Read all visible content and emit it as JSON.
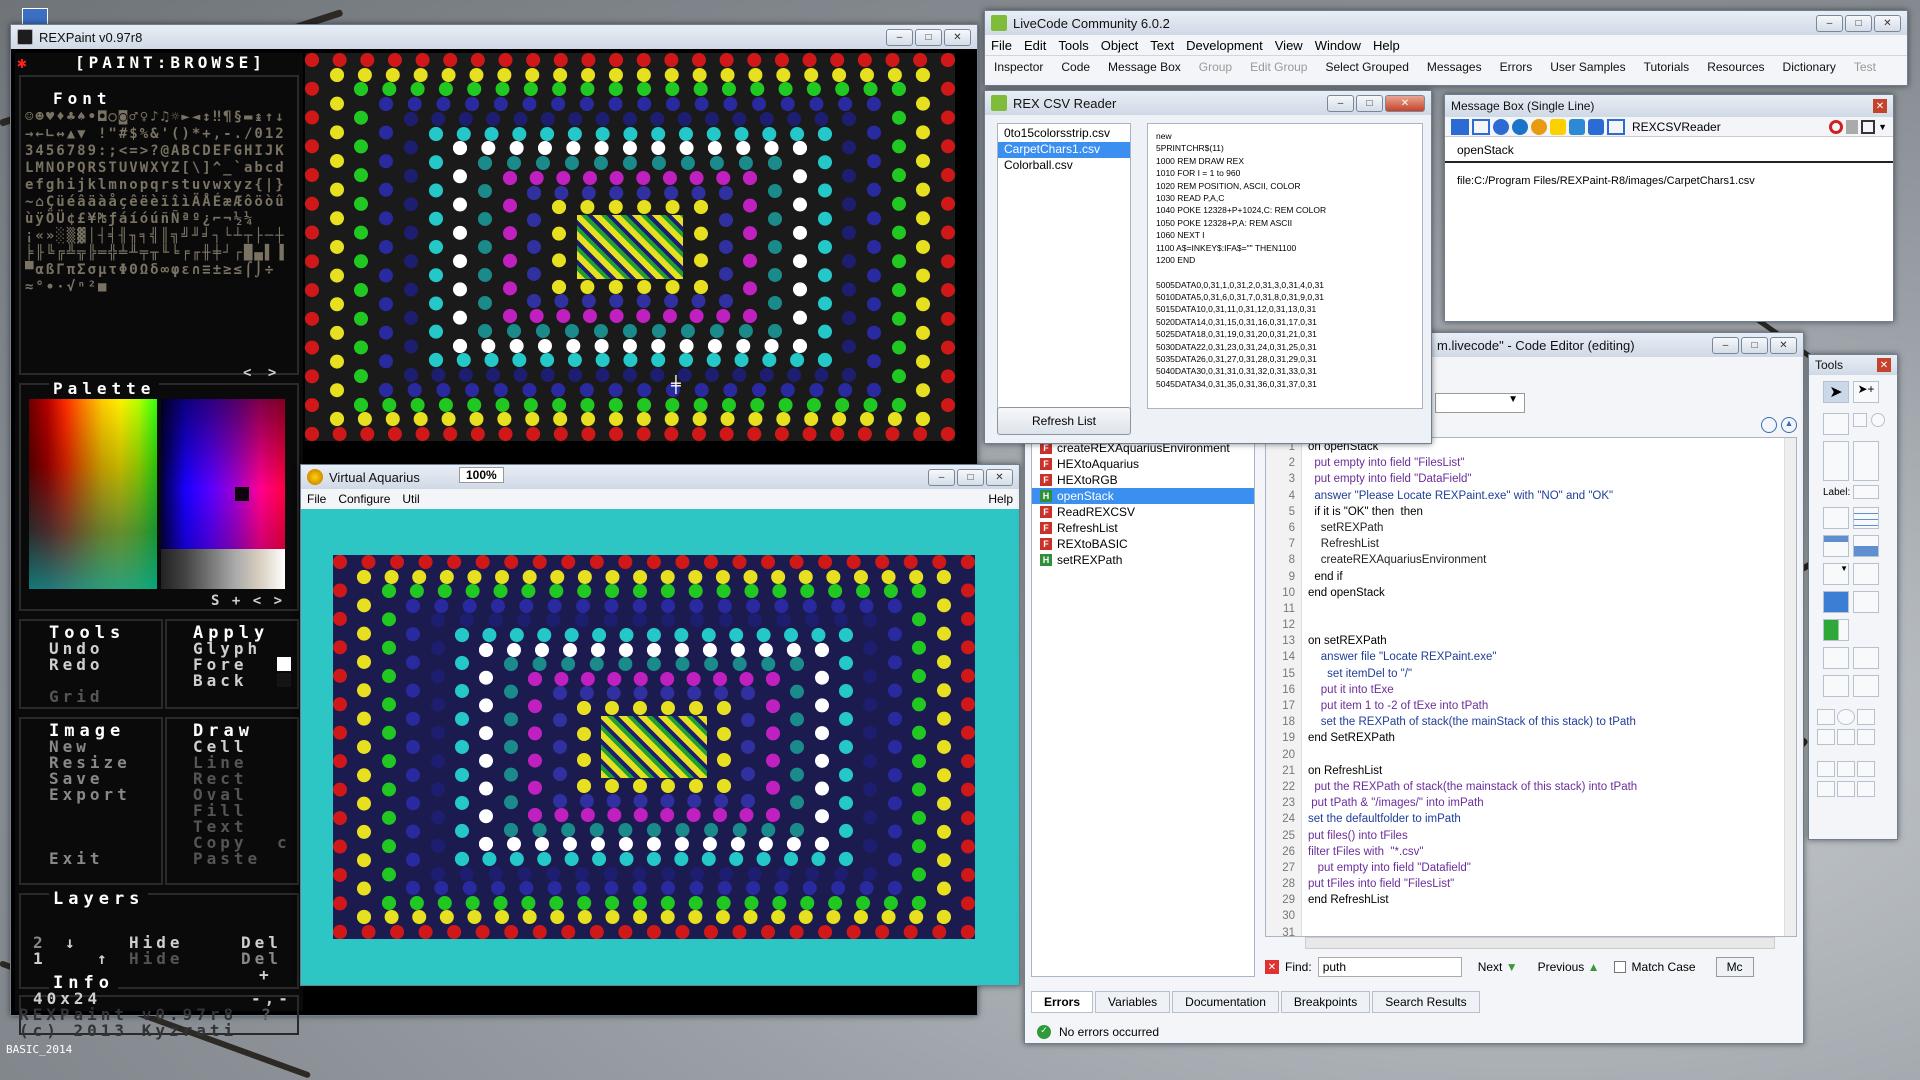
{
  "desktop": {
    "label": "BASIC_2014"
  },
  "rexpaint": {
    "title": "REXPaint v0.97r8",
    "mode_tab": "[PAINT:BROWSE]",
    "font_heading": "Font",
    "font_glyphs": "☺☻♥♦♣♠•◘○◙♂♀♪♫☼►◄↕‼¶§▬↨↑↓→←∟↔▲▼ !\"#$%&'()*+,-./0123456789:;<=>?@ABCDEFGHIJKLMNOPQRSTUVWXYZ[\\]^_`abcdefghijklmnopqrstuvwxyz{|}~⌂ÇüéâäàåçêëèïîìÄÅÉæÆôöòûùÿÖÜ¢£¥₧ƒáíóúñÑªº¿⌐¬½¼¡«»░▒▓│┤╡╢╖╕╣║╗╝╜╛┐└┴┬├─┼╞╟╚╔╩╦╠═╬╧╨╤╥╙╘╒╓╫╪┘┌█▄▌▐▀αßΓπΣσµτΦΘΩδ∞φε∩≡±≥≤⌠⌡÷≈°∙·√ⁿ²■",
    "font_nav": "< >",
    "palette_heading": "Palette",
    "palette_nav": "S + < >",
    "tools_heading": "Tools",
    "undo": "Undo",
    "redo": "Redo",
    "grid": "Grid",
    "apply_heading": "Apply",
    "glyph": "Glyph",
    "fore": "Fore",
    "back": "Back",
    "image_heading": "Image",
    "new": "New",
    "resize": "Resize",
    "save": "Save",
    "export": "Export",
    "exit": "Exit",
    "draw_heading": "Draw",
    "cell": "Cell",
    "line": "Line",
    "rect": "Rect",
    "oval": "Oval",
    "fill": "Fill",
    "text": "Text",
    "copy": "Copy",
    "paste": "Paste",
    "copy_c": "c",
    "layers_heading": "Layers",
    "layer_2": "2",
    "layer_1": "1",
    "hide_2": "Hide",
    "hide_1": "Hide",
    "del_2": "Del",
    "del_1": "Del",
    "layer_add": "+",
    "info_heading": "Info",
    "info_size": "40x24",
    "info_coords": "-,-",
    "info_help": "?",
    "footer_version": "REXPaint v0.97r8",
    "footer_copy": "(c) 2013 Kyzrati"
  },
  "aquarius": {
    "title": "Virtual Aquarius",
    "zoom": "100%",
    "menu": [
      "File",
      "Configure",
      "Util"
    ],
    "help": "Help"
  },
  "livecode": {
    "title": "LiveCode Community 6.0.2",
    "menu": [
      "File",
      "Edit",
      "Tools",
      "Object",
      "Text",
      "Development",
      "View",
      "Window",
      "Help"
    ],
    "toolbar": [
      "Inspector",
      "Code",
      "Message Box",
      "Group",
      "Edit Group",
      "Select Grouped",
      "Messages",
      "Errors",
      "User Samples",
      "Tutorials",
      "Resources",
      "Dictionary",
      "Test"
    ]
  },
  "csvreader": {
    "title": "REX CSV Reader",
    "files": [
      "0to15colorsstrip.csv",
      "CarpetChars1.csv",
      "Colorball.csv"
    ],
    "selected_index": 1,
    "data_lines": [
      "new",
      "5PRINTCHR$(11)",
      "1000 REM DRAW REX",
      "1010 FOR I = 1 to 960",
      "1020 REM POSITION, ASCII, COLOR",
      "1030 READ P,A,C",
      "1040 POKE 12328+P+1024,C: REM COLOR",
      "1050 POKE 12328+P,A: REM ASCII",
      "1060 NEXT I",
      "1100 A$=INKEY$:IFA$=\"\" THEN1100",
      "1200 END",
      "",
      "5005DATA0,0,31,1,0,31,2,0,31,3,0,31,4,0,31",
      "5010DATA5,0,31,6,0,31,7,0,31,8,0,31,9,0,31",
      "5015DATA10,0,31,11,0,31,12,0,31,13,0,31",
      "5020DATA14,0,31,15,0,31,16,0,31,17,0,31",
      "5025DATA18,0,31,19,0,31,20,0,31,21,0,31",
      "5030DATA22,0,31,23,0,31,24,0,31,25,0,31",
      "5035DATA26,0,31,27,0,31,28,0,31,29,0,31",
      "5040DATA30,0,31,31,0,31,32,0,31,33,0,31",
      "5045DATA34,0,31,35,0,31,36,0,31,37,0,31"
    ],
    "refresh_button": "Refresh List"
  },
  "messagebox": {
    "title": "Message Box (Single Line)",
    "stack_name": "REXCSVReader",
    "command": "openStack",
    "result": "file:C:/Program Files/REXPaint-R8/images/CarpetChars1.csv"
  },
  "codeeditor": {
    "title": "m.livecode\" - Code Editor (editing)",
    "handlers": [
      {
        "type": "F",
        "name": "createREXAquariusEnvironment",
        "color": "#c8322b"
      },
      {
        "type": "F",
        "name": "HEXtoAquarius",
        "color": "#c8322b"
      },
      {
        "type": "F",
        "name": "HEXtoRGB",
        "color": "#c8322b"
      },
      {
        "type": "H",
        "name": "openStack",
        "color": "#2f8f3a"
      },
      {
        "type": "F",
        "name": "ReadREXCSV",
        "color": "#c8322b"
      },
      {
        "type": "F",
        "name": "RefreshList",
        "color": "#c8322b"
      },
      {
        "type": "F",
        "name": "REXtoBASIC",
        "color": "#c8322b"
      },
      {
        "type": "H",
        "name": "setREXPath",
        "color": "#2f8f3a"
      }
    ],
    "selected_handler": 3,
    "line_numbers": [
      "1",
      "2",
      "3",
      "4",
      "5",
      "6",
      "7",
      "8",
      "9",
      "10",
      "11",
      "12",
      "13",
      "14",
      "15",
      "16",
      "17",
      "18",
      "19",
      "20",
      "21",
      "22",
      "23",
      "24",
      "25",
      "26",
      "27",
      "28",
      "29",
      "30",
      "31"
    ],
    "code": [
      "on openStack",
      "  put empty into field \"FilesList\"",
      "  put empty into field \"DataField\"",
      "  answer \"Please Locate REXPaint.exe\" with \"NO\" and \"OK\"",
      "  if it is \"OK\" then  then",
      "    setREXPath",
      "    RefreshList",
      "    createREXAquariusEnvironment",
      "  end if",
      "end openStack",
      "",
      "",
      "on setREXPath",
      "    answer file \"Locate REXPaint.exe\"",
      "      set itemDel to \"/\"",
      "    put it into tExe",
      "    put item 1 to -2 of tExe into tPath",
      "    set the REXPath of stack(the mainStack of this stack) to tPath",
      "end SetREXPath",
      "",
      "on RefreshList",
      "  put the REXPath of stack(the mainstack of this stack) into tPath",
      " put tPath & \"/images/\" into imPath",
      "set the defaultfolder to imPath",
      "put files() into tFiles",
      "filter tFiles with  \"*.csv\"",
      "   put empty into field \"Datafield\"",
      "put tFiles into field \"FilesList\"",
      "end RefreshList",
      "",
      ""
    ],
    "find_label": "Find:",
    "find_value": "puth",
    "next": "Next",
    "previous": "Previous",
    "match_case": "Match Case",
    "more_button": "Mc",
    "tabs": [
      "Errors",
      "Variables",
      "Documentation",
      "Breakpoints",
      "Search Results"
    ],
    "status": "No errors occurred"
  },
  "tools": {
    "title": "Tools",
    "label_tool": "Label:"
  }
}
